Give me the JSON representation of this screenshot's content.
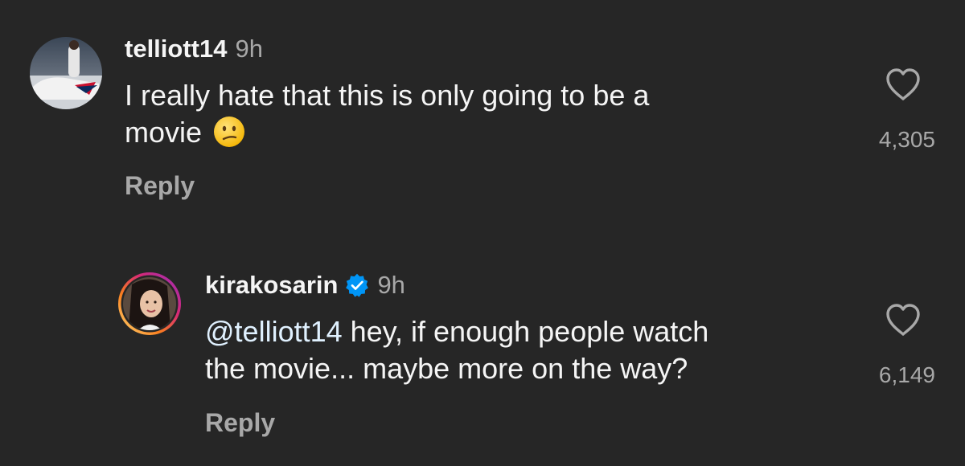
{
  "comments": [
    {
      "username": "telliott14",
      "time": "9h",
      "line1": "I really hate that this is only going to be a",
      "line2": "movie",
      "emoji": "confused-face-emoji",
      "reply_label": "Reply",
      "likes": "4,305",
      "avatar": "avatar-photo"
    },
    {
      "username": "kirakosarin",
      "verified": true,
      "time": "9h",
      "mention": "@telliott14",
      "line1_rest": " hey, if enough people watch",
      "line2": "the movie... maybe more on the way?",
      "reply_label": "Reply",
      "likes": "6,149",
      "avatar": "avatar-photo-story-ring"
    }
  ],
  "colors": {
    "background": "#262626",
    "primary_text": "#f5f5f5",
    "secondary_text": "#a8a8a8",
    "mention": "#e0f1ff",
    "verified_badge": "#0095f6"
  }
}
